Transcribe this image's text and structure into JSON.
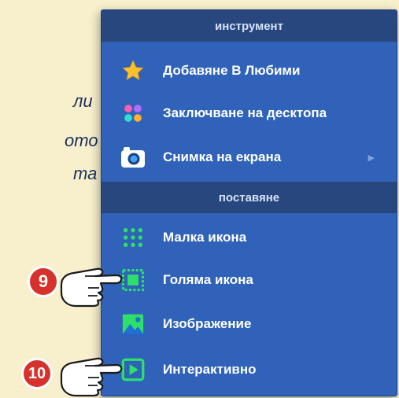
{
  "background_text": {
    "line1": "ли",
    "line2": "ото",
    "line3": "та"
  },
  "menu": {
    "section_tool": "инструмент",
    "section_display": "поставяне",
    "items": [
      {
        "label": "Добавяне В Любими",
        "icon": "star-icon"
      },
      {
        "label": "Заключване на десктопа",
        "icon": "color-dots-icon"
      },
      {
        "label": "Снимка на екрана",
        "icon": "camera-icon",
        "submenu_arrow": "▶"
      },
      {
        "label": "Малка икона",
        "icon": "small-icons-grid-icon"
      },
      {
        "label": "Голяма икона",
        "icon": "large-icon-icon"
      },
      {
        "label": "Изображение",
        "icon": "image-icon"
      },
      {
        "label": "Интерактивно",
        "icon": "play-icon"
      }
    ]
  },
  "callouts": [
    {
      "number": "9"
    },
    {
      "number": "10"
    }
  ],
  "colors": {
    "menu_bg": "#2f62b8",
    "header_bg": "#29477f",
    "accent_green": "#2ee06a",
    "badge_red": "#d6312b",
    "page_bg": "#f8efcd"
  }
}
